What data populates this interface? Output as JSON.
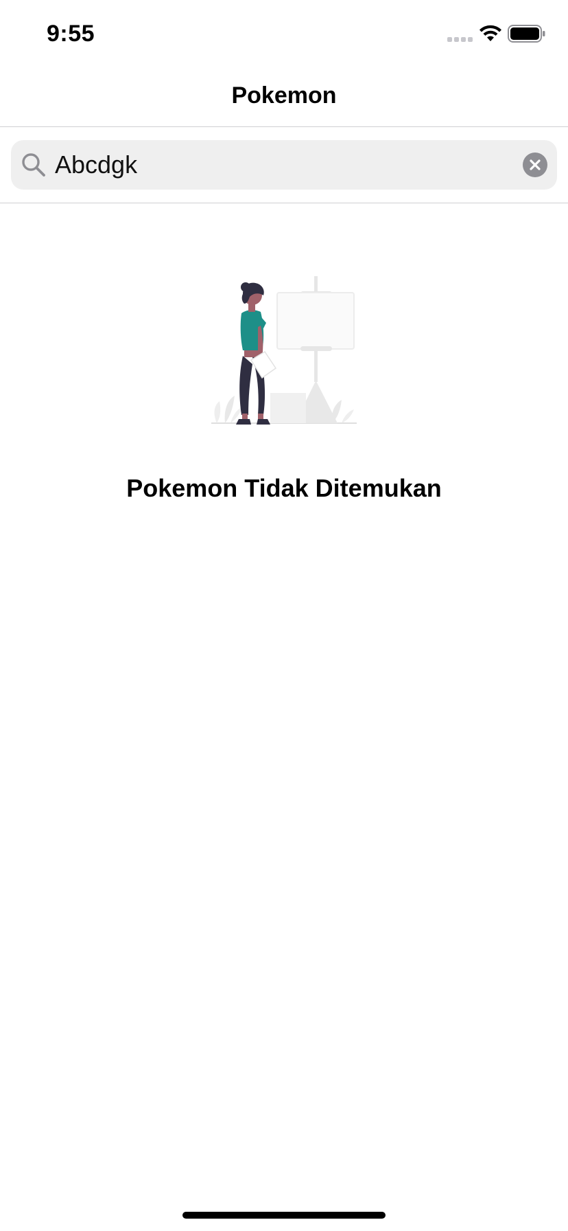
{
  "status_bar": {
    "time": "9:55",
    "signal_icon": "cellular-signal-icon",
    "wifi_icon": "wifi-icon",
    "battery_icon": "battery-icon"
  },
  "nav": {
    "title": "Pokemon"
  },
  "search": {
    "value": "Abcdgk",
    "search_icon": "search-icon",
    "clear_icon": "clear-circle-icon"
  },
  "empty_state": {
    "illustration": "person-with-easel-illustration",
    "message": "Pokemon Tidak Ditemukan"
  },
  "colors": {
    "accent_teal": "#1d8f88",
    "field_background": "#efefef",
    "separator": "#cfcfd2"
  }
}
